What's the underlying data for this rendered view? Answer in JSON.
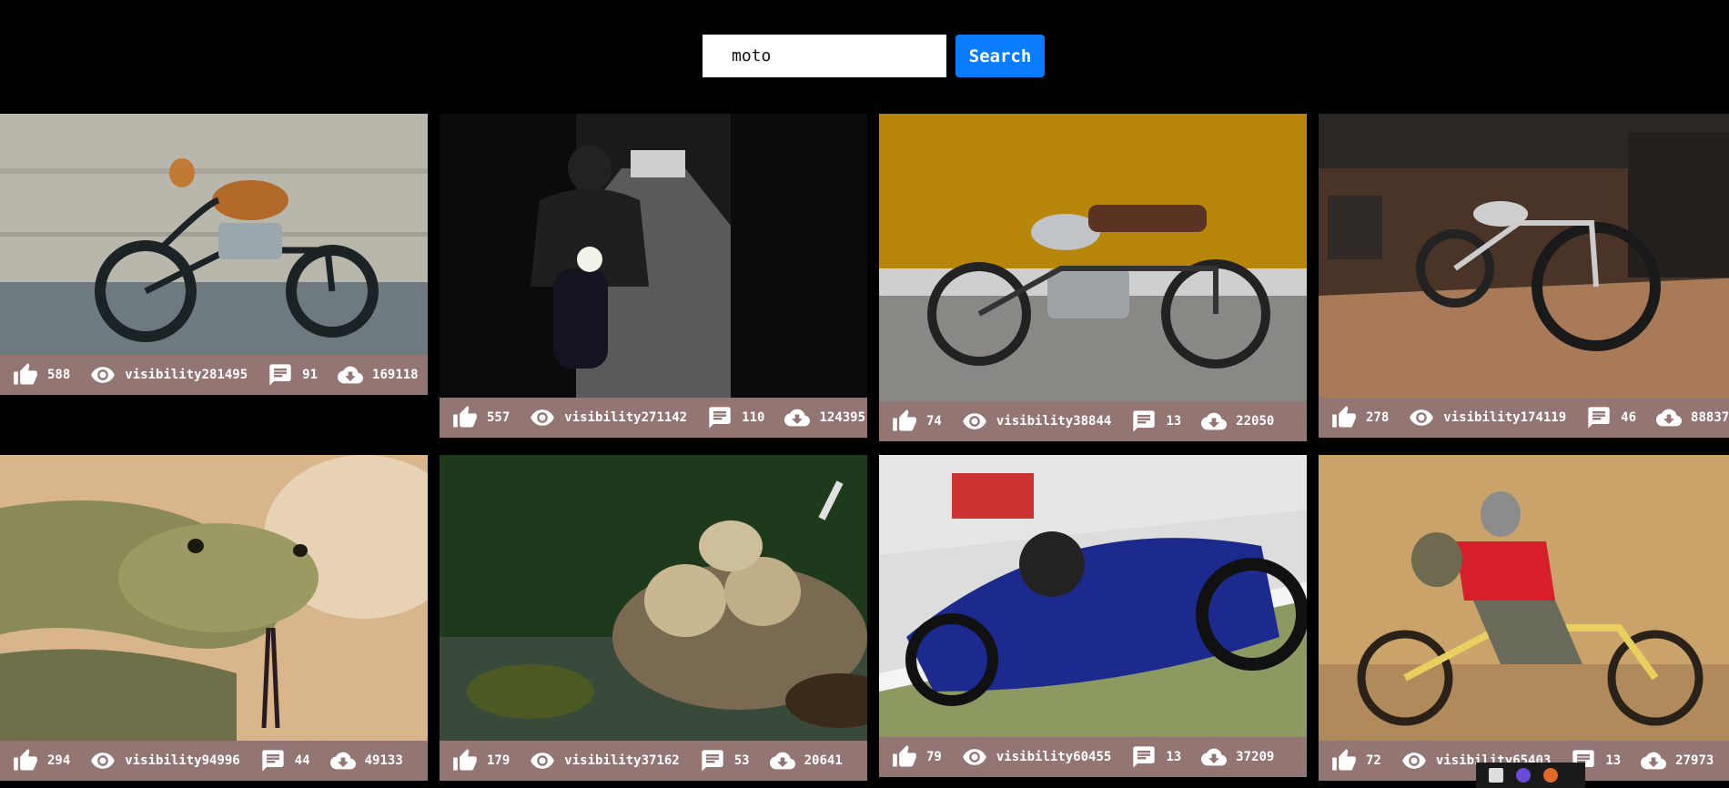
{
  "search": {
    "value": "moto",
    "placeholder": "",
    "button_label": "Search"
  },
  "cards": [
    {
      "subject": "vintage-motorcycle",
      "likes": "588",
      "views_label": "visibility",
      "views": "281495",
      "comments": "91",
      "downloads": "169118"
    },
    {
      "subject": "rider-on-road",
      "likes": "557",
      "views_label": "visibility",
      "views": "271142",
      "comments": "110",
      "downloads": "124395"
    },
    {
      "subject": "royal-enfield",
      "likes": "74",
      "views_label": "visibility",
      "views": "38844",
      "comments": "13",
      "downloads": "22050"
    },
    {
      "subject": "garage-motorcycle",
      "likes": "278",
      "views_label": "visibility",
      "views": "174119",
      "comments": "46",
      "downloads": "88837"
    },
    {
      "subject": "rattlesnake",
      "likes": "294",
      "views_label": "visibility",
      "views": "94996",
      "comments": "44",
      "downloads": "49133"
    },
    {
      "subject": "nest-with-eggs",
      "likes": "179",
      "views_label": "visibility",
      "views": "37162",
      "comments": "53",
      "downloads": "20641"
    },
    {
      "subject": "racing-motorcycle",
      "likes": "79",
      "views_label": "visibility",
      "views": "60455",
      "comments": "13",
      "downloads": "37209"
    },
    {
      "subject": "dirt-bike-rider",
      "likes": "72",
      "views_label": "visibility",
      "views": "65403",
      "comments": "13",
      "downloads": "27973"
    }
  ],
  "colors": {
    "background": "#000000",
    "stats_bar": "#937574",
    "search_button": "#0a7cff"
  }
}
